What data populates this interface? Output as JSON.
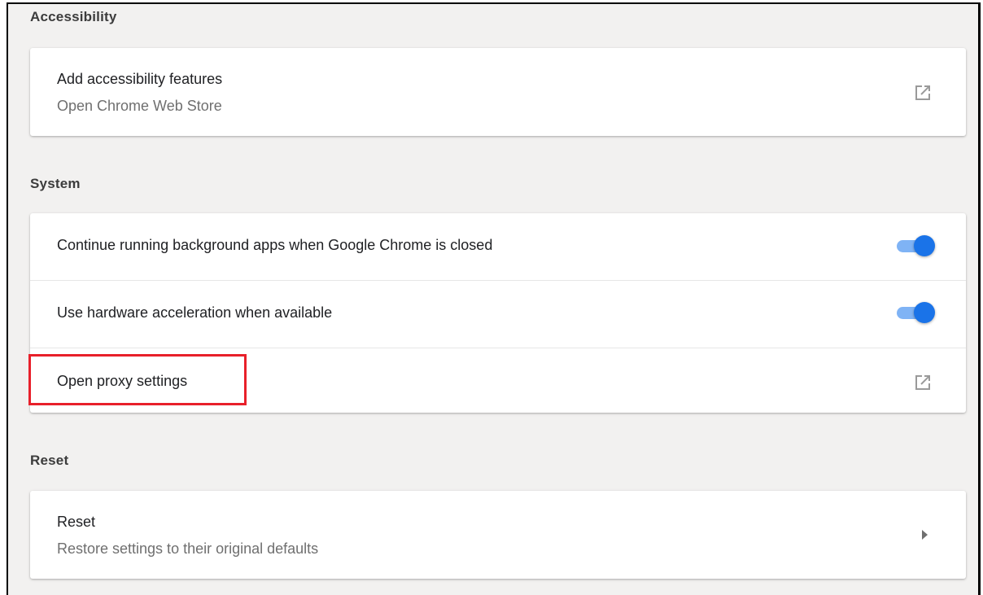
{
  "sections": {
    "accessibility": {
      "title": "Accessibility",
      "item": {
        "label": "Add accessibility features",
        "sublabel": "Open Chrome Web Store",
        "icon": "open-in-new-icon"
      }
    },
    "system": {
      "title": "System",
      "items": [
        {
          "label": "Continue running background apps when Google Chrome is closed",
          "control": "toggle",
          "state": "on"
        },
        {
          "label": "Use hardware acceleration when available",
          "control": "toggle",
          "state": "on"
        },
        {
          "label": "Open proxy settings",
          "icon": "open-in-new-icon",
          "highlighted": true
        }
      ]
    },
    "reset": {
      "title": "Reset",
      "item": {
        "label": "Reset",
        "sublabel": "Restore settings to their original defaults",
        "icon": "chevron-right-icon"
      }
    }
  },
  "colors": {
    "background": "#f2f1f0",
    "card": "#ffffff",
    "toggle_knob": "#1a73e8",
    "toggle_track": "#7fb3f5",
    "highlight": "#e8202a",
    "text_primary": "#202124",
    "text_secondary": "#6f6f6f"
  }
}
